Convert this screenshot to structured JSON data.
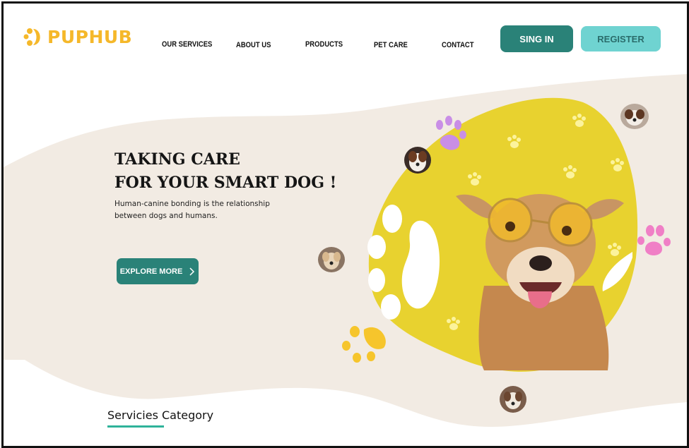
{
  "brand": {
    "name": "PUPHUB"
  },
  "nav": {
    "items": [
      {
        "label": "OUR SERVICES"
      },
      {
        "label": "ABOUT US"
      },
      {
        "label": "PRODUCTS"
      },
      {
        "label": "PET CARE"
      },
      {
        "label": "CONTACT"
      }
    ],
    "signin_label": "SING IN",
    "register_label": "REGISTER"
  },
  "hero": {
    "title_line1": "TAKING CARE",
    "title_line2": "FOR YOUR SMART DOG !",
    "subtitle": "Human-canine bonding is the relationship between dogs and humans.",
    "cta_label": "EXPLORE MORE"
  },
  "section": {
    "title": "Servicies Category"
  },
  "colors": {
    "accent_teal": "#2a8278",
    "light_teal": "#6fd3d1",
    "hero_yellow": "#e8d22f",
    "beige": "#f2ebe3",
    "paw_purple": "#c98ee6",
    "paw_pink": "#f07fc6",
    "paw_gold": "#f6c52c"
  },
  "icons": [
    "paw-logo-icon",
    "chevron-right-icon",
    "paw-print-icon",
    "dog-avatar-icon"
  ]
}
